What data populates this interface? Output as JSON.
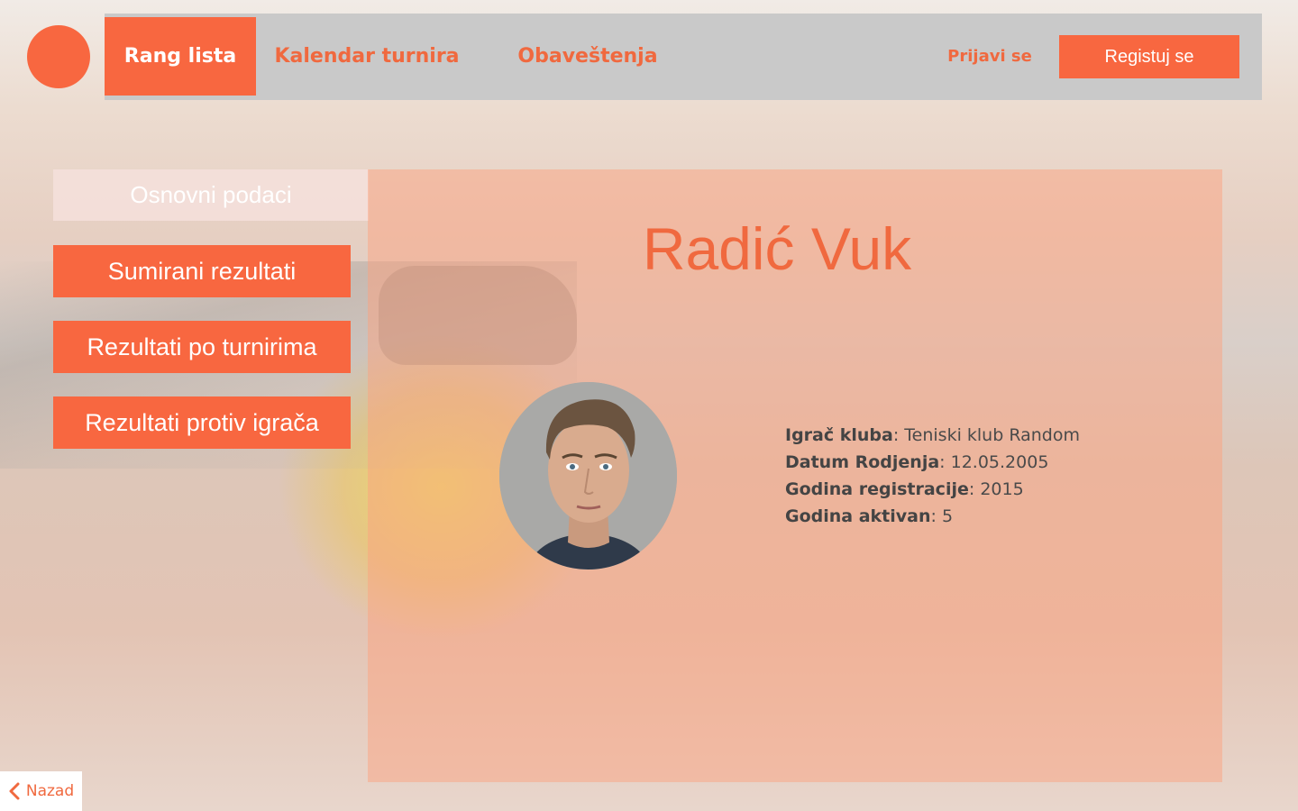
{
  "header": {
    "nav": [
      {
        "label": "Rang lista",
        "active": true
      },
      {
        "label": "Kalendar turnira",
        "active": false
      },
      {
        "label": "Obaveštenja",
        "active": false
      }
    ],
    "login_label": "Prijavi se",
    "register_label": "Registuj se"
  },
  "sidebar": {
    "items": [
      {
        "label": "Osnovni podaci",
        "active": true
      },
      {
        "label": "Sumirani rezultati"
      },
      {
        "label": "Rezultati po turnirima"
      },
      {
        "label": "Rezultati protiv igrača"
      }
    ]
  },
  "player": {
    "name": "Radić Vuk",
    "fields": [
      {
        "label": "Igrač kluba",
        "value": "Teniski klub Random"
      },
      {
        "label": "Datum Rodjenja",
        "value": "12.05.2005"
      },
      {
        "label": "Godina registracije",
        "value": "2015"
      },
      {
        "label": "Godina aktivan",
        "value": "5"
      }
    ]
  },
  "footer": {
    "back_label": "Nazad"
  },
  "colors": {
    "accent": "#f86740",
    "nav_bg": "#c9c9c9"
  }
}
